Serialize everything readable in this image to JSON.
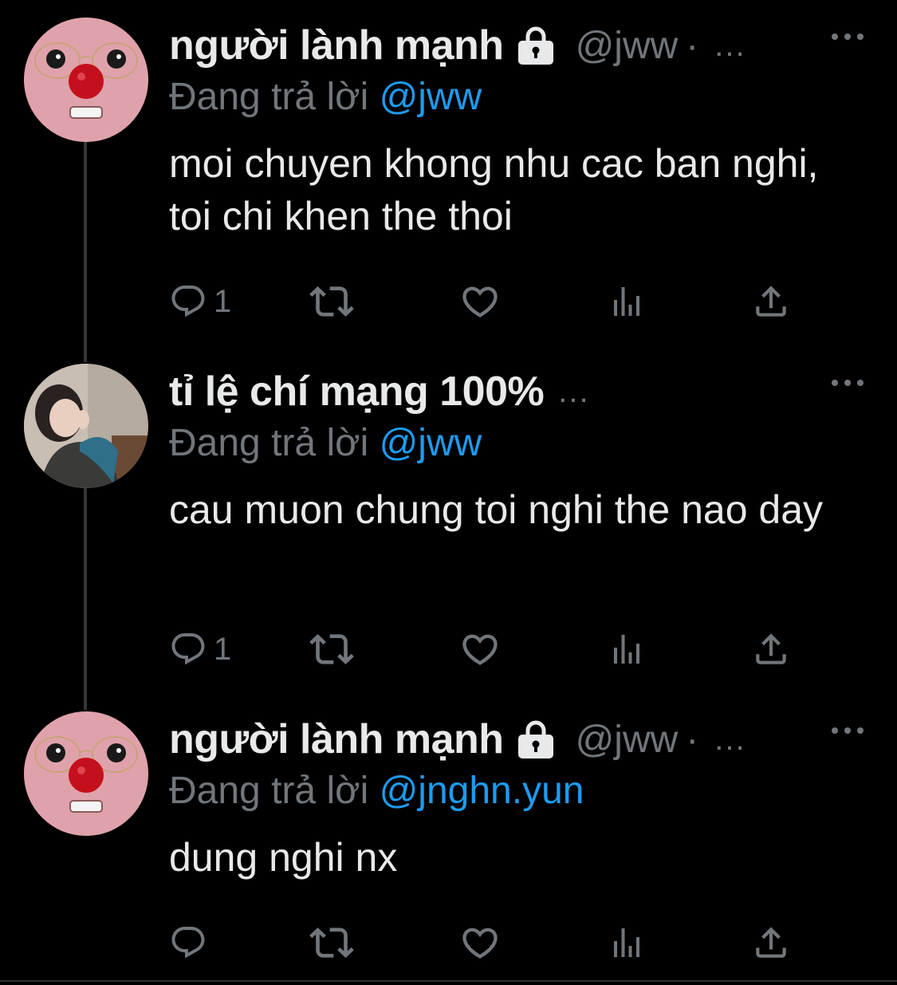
{
  "colors": {
    "background": "#000000",
    "primary_text": "#e7e9ea",
    "secondary_text": "#71767b",
    "mention": "#1d9bf0",
    "thread_line": "#333639"
  },
  "tweets": [
    {
      "display_name": "người lành mạnh",
      "protected": true,
      "protected_icon": "lock-icon",
      "handle": "@jww",
      "separator": "·",
      "truncation": "...",
      "replying_prefix": "Đang trả lời ",
      "replying_to": "@jww",
      "text": "moi chuyen khong nhu cac ban nghi, toi chi khen the thoi",
      "reply_count": "1",
      "avatar": "pink-clown-avatar"
    },
    {
      "display_name": "tỉ lệ chí mạng 100%",
      "protected": false,
      "handle": "",
      "separator": "",
      "truncation": "...",
      "replying_prefix": "Đang trả lời ",
      "replying_to": "@jww",
      "text": "cau muon chung toi nghi the nao day",
      "reply_count": "1",
      "avatar": "person-photo-avatar"
    },
    {
      "display_name": "người lành mạnh",
      "protected": true,
      "protected_icon": "lock-icon",
      "handle": "@jww",
      "separator": "·",
      "truncation": "...",
      "replying_prefix": "Đang trả lời ",
      "replying_to": "@jnghn.yun",
      "text": "dung nghi nx",
      "reply_count": "",
      "avatar": "pink-clown-avatar"
    }
  ],
  "action_icons": [
    "reply-icon",
    "retweet-icon",
    "like-icon",
    "views-icon",
    "share-icon"
  ],
  "more_icon": "more-icon"
}
